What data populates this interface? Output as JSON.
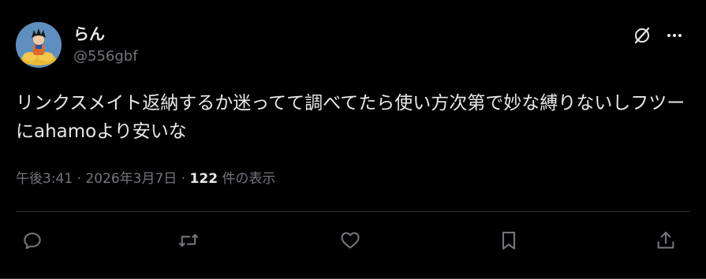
{
  "tweet": {
    "display_name": "らん",
    "handle": "@556gbf",
    "avatar_icon": "avatar-image",
    "text": "リンクスメイト返納するか迷ってて調べてたら使い方次第で妙な縛りないしフツーにahamoより安いな",
    "time": "午後3:41",
    "separator": "·",
    "date": "2026年3月7日",
    "views_count": "122",
    "views_label": "件の表示"
  },
  "header_actions": {
    "grok_icon": "grok-icon",
    "more_icon": "more-icon"
  },
  "actions": [
    {
      "icon": "reply-icon"
    },
    {
      "icon": "retweet-icon"
    },
    {
      "icon": "like-icon"
    },
    {
      "icon": "bookmark-icon"
    },
    {
      "icon": "share-icon"
    }
  ],
  "colors": {
    "background": "#000000",
    "primary_text": "#e7e9ea",
    "secondary_text": "#71767b",
    "divider": "#2f3336"
  }
}
